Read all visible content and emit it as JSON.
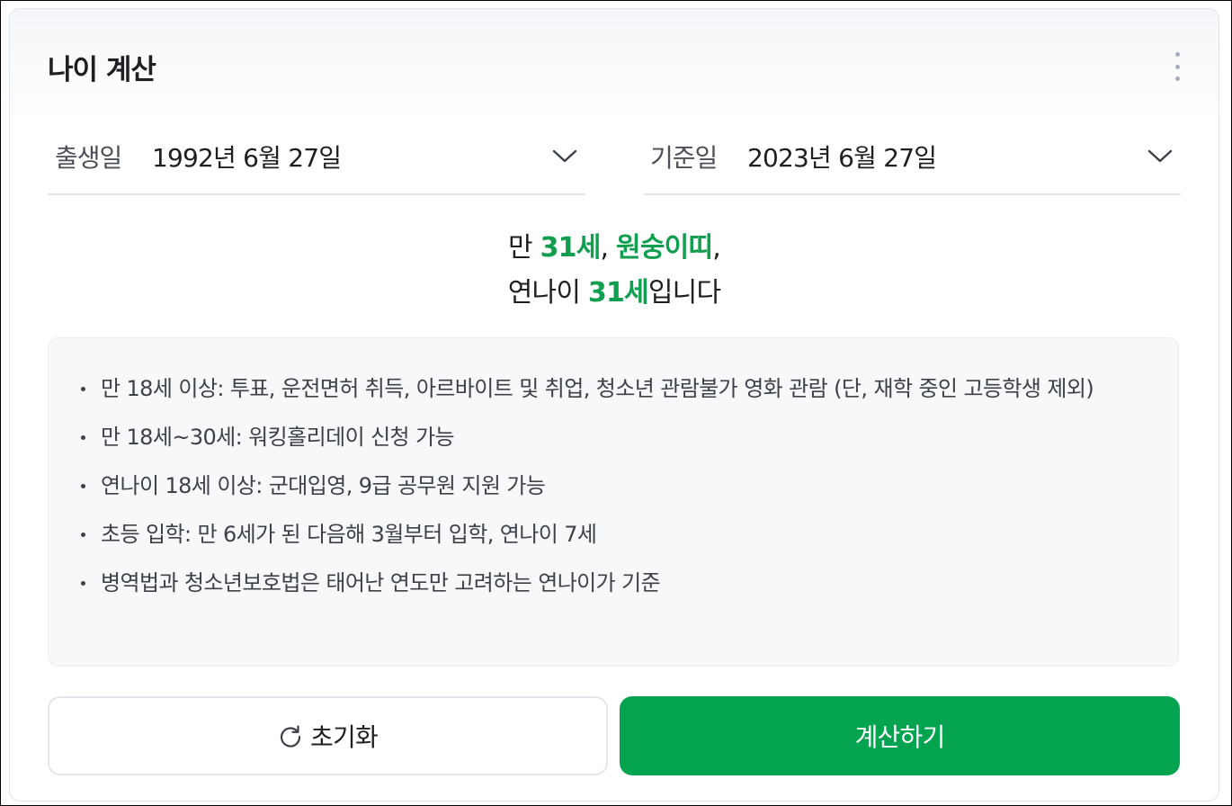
{
  "widget": {
    "title": "나이 계산",
    "more_icon": "more-vertical-icon"
  },
  "fields": {
    "birth": {
      "label": "출생일",
      "value": "1992년 6월 27일"
    },
    "base": {
      "label": "기준일",
      "value": "2023년 6월 27일"
    }
  },
  "result": {
    "line1_prefix": "만 ",
    "man_age": "31세",
    "sep1": ", ",
    "zodiac": "원숭이띠",
    "sep2": ",",
    "line2_prefix": "연나이 ",
    "year_age": "31세",
    "line2_suffix": "입니다"
  },
  "info": [
    "만 18세 이상: 투표, 운전면허 취득, 아르바이트 및 취업, 청소년 관람불가 영화 관람 (단, 재학 중인 고등학생 제외)",
    "만 18세~30세: 워킹홀리데이 신청 가능",
    "연나이 18세 이상: 군대입영, 9급 공무원 지원 가능",
    "초등 입학: 만 6세가 된 다음해 3월부터 입학, 연나이 7세",
    "병역법과 청소년보호법은 태어난 연도만 고려하는 연나이가 기준"
  ],
  "buttons": {
    "reset": "초기화",
    "calculate": "계산하기"
  },
  "colors": {
    "accent": "#03a350",
    "highlight": "#109e4f"
  }
}
